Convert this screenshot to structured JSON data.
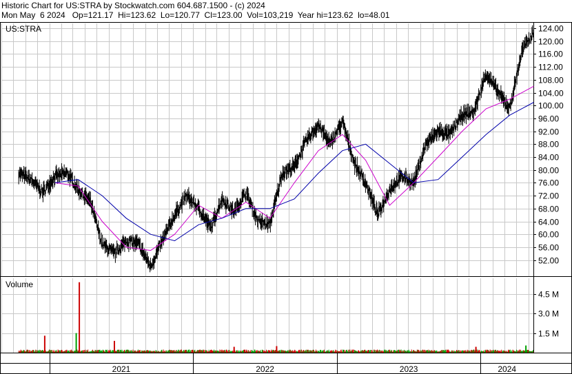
{
  "header": {
    "line1": "Historic Chart for US:STRA by Stockwatch.com 604.687.1500 - (c) 2024",
    "line2": "Mon May  6 2024   Op=121.17  Hi=123.62  Lo=120.77  Cl=123.00  Vol=103,219  Year hi=123.62  lo=48.01"
  },
  "chart_data": [
    {
      "type": "line",
      "title": "US:STRA",
      "y_ticks": [
        52,
        56,
        60,
        64,
        68,
        72,
        76,
        80,
        84,
        88,
        92,
        96,
        100,
        104,
        108,
        112,
        116,
        120,
        124
      ],
      "ylim": [
        47,
        125.5
      ],
      "x_labels": [
        "2021",
        "2022",
        "2023",
        "2024"
      ],
      "grid": true,
      "series": [
        {
          "kind": "price_hilo",
          "color": "#000000",
          "values": [
            {
              "x": "2020-10",
              "y": 79
            },
            {
              "x": "2020-11",
              "y": 77
            },
            {
              "x": "2020-12",
              "y": 73
            },
            {
              "x": "2021-01",
              "y": 78
            },
            {
              "x": "2021-02",
              "y": 79
            },
            {
              "x": "2021-03",
              "y": 74
            },
            {
              "x": "2021-04",
              "y": 70
            },
            {
              "x": "2021-05",
              "y": 57
            },
            {
              "x": "2021-06",
              "y": 54
            },
            {
              "x": "2021-07",
              "y": 58
            },
            {
              "x": "2021-08",
              "y": 57
            },
            {
              "x": "2021-09",
              "y": 50
            },
            {
              "x": "2021-10",
              "y": 58
            },
            {
              "x": "2021-11",
              "y": 66
            },
            {
              "x": "2021-12",
              "y": 72
            },
            {
              "x": "2022-01",
              "y": 68
            },
            {
              "x": "2022-02",
              "y": 62
            },
            {
              "x": "2022-03",
              "y": 71
            },
            {
              "x": "2022-04",
              "y": 67
            },
            {
              "x": "2022-05",
              "y": 73
            },
            {
              "x": "2022-06",
              "y": 64
            },
            {
              "x": "2022-07",
              "y": 63
            },
            {
              "x": "2022-08",
              "y": 79
            },
            {
              "x": "2022-09",
              "y": 81
            },
            {
              "x": "2022-10",
              "y": 89
            },
            {
              "x": "2022-11",
              "y": 94
            },
            {
              "x": "2022-12",
              "y": 88
            },
            {
              "x": "2023-01",
              "y": 95
            },
            {
              "x": "2023-02",
              "y": 82
            },
            {
              "x": "2023-03",
              "y": 76
            },
            {
              "x": "2023-04",
              "y": 66
            },
            {
              "x": "2023-05",
              "y": 74
            },
            {
              "x": "2023-06",
              "y": 78
            },
            {
              "x": "2023-07",
              "y": 76
            },
            {
              "x": "2023-08",
              "y": 88
            },
            {
              "x": "2023-09",
              "y": 92
            },
            {
              "x": "2023-10",
              "y": 91
            },
            {
              "x": "2023-11",
              "y": 97
            },
            {
              "x": "2023-12",
              "y": 98
            },
            {
              "x": "2024-01",
              "y": 110
            },
            {
              "x": "2024-02",
              "y": 104
            },
            {
              "x": "2024-03",
              "y": 99
            },
            {
              "x": "2024-04",
              "y": 117
            },
            {
              "x": "2024-05",
              "y": 123
            }
          ]
        },
        {
          "kind": "moving_average_short",
          "color": "#cc00cc",
          "values": [
            {
              "x": "2021-01",
              "y": 76
            },
            {
              "x": "2021-03",
              "y": 75
            },
            {
              "x": "2021-05",
              "y": 64
            },
            {
              "x": "2021-07",
              "y": 56
            },
            {
              "x": "2021-09",
              "y": 55
            },
            {
              "x": "2021-11",
              "y": 60
            },
            {
              "x": "2022-01",
              "y": 69
            },
            {
              "x": "2022-03",
              "y": 65
            },
            {
              "x": "2022-05",
              "y": 70
            },
            {
              "x": "2022-07",
              "y": 65
            },
            {
              "x": "2022-09",
              "y": 76
            },
            {
              "x": "2022-11",
              "y": 86
            },
            {
              "x": "2023-01",
              "y": 91
            },
            {
              "x": "2023-03",
              "y": 83
            },
            {
              "x": "2023-05",
              "y": 69
            },
            {
              "x": "2023-07",
              "y": 76
            },
            {
              "x": "2023-09",
              "y": 84
            },
            {
              "x": "2023-11",
              "y": 92
            },
            {
              "x": "2024-01",
              "y": 99
            },
            {
              "x": "2024-03",
              "y": 102
            },
            {
              "x": "2024-05",
              "y": 106
            }
          ]
        },
        {
          "kind": "moving_average_long",
          "color": "#0000aa",
          "values": [
            {
              "x": "2021-01",
              "y": 76
            },
            {
              "x": "2021-03",
              "y": 77
            },
            {
              "x": "2021-05",
              "y": 72
            },
            {
              "x": "2021-07",
              "y": 65
            },
            {
              "x": "2021-09",
              "y": 60
            },
            {
              "x": "2021-11",
              "y": 58
            },
            {
              "x": "2022-01",
              "y": 63
            },
            {
              "x": "2022-03",
              "y": 65
            },
            {
              "x": "2022-05",
              "y": 68
            },
            {
              "x": "2022-07",
              "y": 68
            },
            {
              "x": "2022-09",
              "y": 71
            },
            {
              "x": "2022-11",
              "y": 79
            },
            {
              "x": "2023-01",
              "y": 86
            },
            {
              "x": "2023-03",
              "y": 88
            },
            {
              "x": "2023-05",
              "y": 82
            },
            {
              "x": "2023-07",
              "y": 76
            },
            {
              "x": "2023-09",
              "y": 77
            },
            {
              "x": "2023-11",
              "y": 84
            },
            {
              "x": "2024-01",
              "y": 91
            },
            {
              "x": "2024-03",
              "y": 97
            },
            {
              "x": "2024-05",
              "y": 101
            }
          ]
        }
      ]
    },
    {
      "type": "bar",
      "title": "Volume",
      "y_ticks": [
        "1.5 M",
        "3.0 M",
        "4.5 M"
      ],
      "y_tick_values": [
        1500000,
        3000000,
        4500000
      ],
      "ylim": [
        0,
        5700000
      ],
      "up_color": "#00a000",
      "down_color": "#cc0000",
      "spikes": [
        {
          "x": "2021-03-18",
          "y": 5400000,
          "color": "down"
        },
        {
          "x": "2020-12-20",
          "y": 1300000,
          "color": "down"
        },
        {
          "x": "2021-03-10",
          "y": 1500000,
          "color": "up"
        },
        {
          "x": "2021-06-15",
          "y": 900000,
          "color": "down"
        },
        {
          "x": "2022-04-15",
          "y": 450000,
          "color": "down"
        },
        {
          "x": "2022-08-01",
          "y": 500000,
          "color": "down"
        },
        {
          "x": "2023-12-20",
          "y": 450000,
          "color": "down"
        },
        {
          "x": "2024-04-25",
          "y": 550000,
          "color": "up"
        }
      ],
      "baseline_volume": 150000
    }
  ]
}
